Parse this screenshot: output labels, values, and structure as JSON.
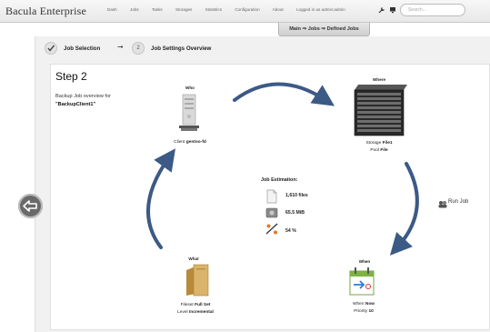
{
  "header": {
    "brand": "Bacula Enterprise",
    "nav": [
      "Dash",
      "Jobs",
      "Tasks",
      "Storages",
      "Statistics",
      "Configuration",
      "About",
      "Logged in as admin:admin"
    ],
    "search_placeholder": "Search..."
  },
  "breadcrumb": "Main ⇒ Jobs ⇒ Defined Jobs",
  "wizard": {
    "step1_label": "Job Selection",
    "step2_number": "2",
    "step2_label": "Job Settings Overview"
  },
  "main": {
    "title": "Step 2",
    "desc_line1": "Backup Job overview for",
    "desc_job": "\"BackupClient1\""
  },
  "who": {
    "heading": "Who",
    "client_prefix": "Client",
    "client_name": "gentoo-fd"
  },
  "where": {
    "heading": "Where",
    "line1_prefix": "Storage",
    "line1_value": "File1",
    "line2_prefix": "Pool",
    "line2_value": "File"
  },
  "what": {
    "heading": "What",
    "line1_prefix": "Fileset",
    "line1_value": "Full Set",
    "line2_prefix": "Level",
    "line2_value": "Incremental"
  },
  "when": {
    "heading": "When",
    "line1_prefix": "When",
    "line1_value": "Now",
    "line2_prefix": "Priority",
    "line2_value": "10"
  },
  "estimation": {
    "title": "Job Estimation:",
    "files": "1,610 files",
    "size": "65.5 MiB",
    "percent": "54 %"
  },
  "run_job_label": "Run Job",
  "colors": {
    "arrow": "#3c5a86",
    "header_bg": "#ececec",
    "frame_bg": "#f1f1f1"
  }
}
